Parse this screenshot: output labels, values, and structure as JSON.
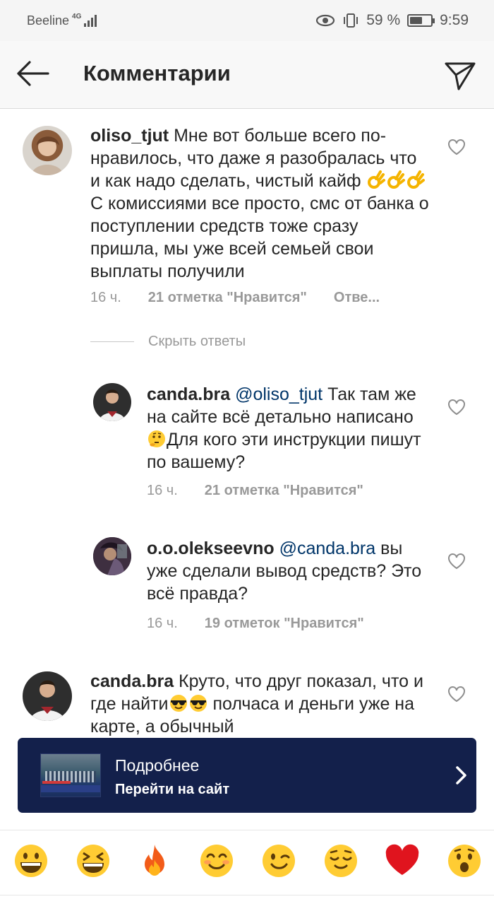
{
  "status_bar": {
    "carrier": "Beeline",
    "network": "4G",
    "battery_percent": "59 %",
    "time": "9:59"
  },
  "header": {
    "title": "Комментарии"
  },
  "comments": [
    {
      "username": "oliso_tjut",
      "text_1": "Мне вот больше всего по-нравилось, что даже я разобралась что и как надо сделать, чистый кайф",
      "text_2": " С комиссиями все просто, смс от банка о поступлении средств тоже сразу пришла, мы уже всей семьей свои выплаты получили",
      "time": "16 ч.",
      "likes": "21 отметка \"Нравится\"",
      "reply": "Отве..."
    },
    {
      "username": "canda.bra",
      "mention": "@oliso_tjut",
      "text_1": " Так там же на сайте всё детально написано",
      "text_2": "Для кого эти инструкции пишут по вашему?",
      "time": "16 ч.",
      "likes": "21 отметка \"Нравится\""
    },
    {
      "username": "o.o.olekseevno",
      "mention": "@canda.bra",
      "text_1": " вы уже сделали вывод средств? Это всё правда?",
      "time": "16 ч.",
      "likes": "19 отметок \"Нравится\""
    },
    {
      "username": "canda.bra",
      "text_1": " Круто, что друг показал, что и где найти",
      "text_2": " полчаса и деньги уже на карте, а обычный"
    }
  ],
  "hide_replies": "Скрыть ответы",
  "banner": {
    "title": "Подробнее",
    "subtitle": "Перейти на сайт"
  },
  "emoji_bar": [
    "grinning-face",
    "laughing-face",
    "fire",
    "smiling-face",
    "winking-face",
    "relieved-face",
    "red-heart",
    "surprised-face"
  ],
  "colors": {
    "banner_bg": "#13204b",
    "mention": "#003569",
    "meta_text": "#999999"
  }
}
